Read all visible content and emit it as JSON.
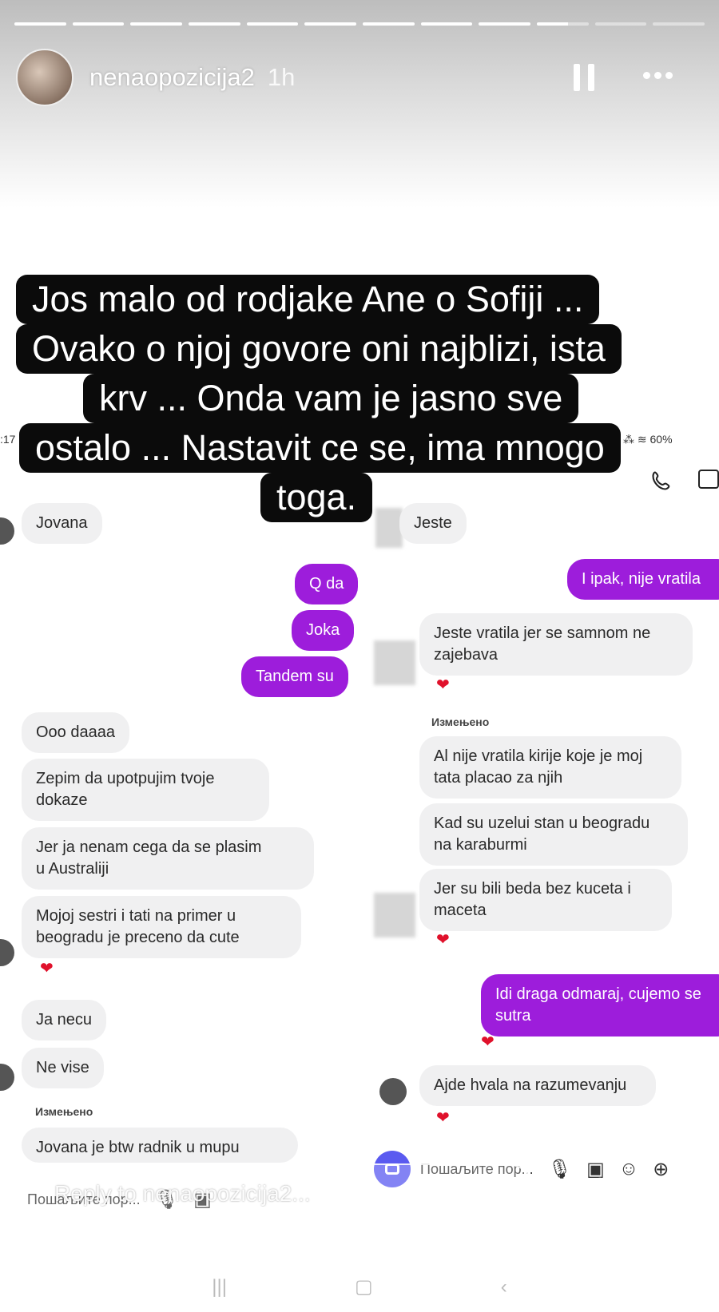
{
  "story": {
    "username": "nenaopozicija2",
    "time": "1h",
    "progress": [
      1,
      1,
      1,
      1,
      1,
      1,
      1,
      1,
      1,
      0.6,
      0,
      0
    ]
  },
  "caption": {
    "lines": [
      "Jos malo od rodjake Ane o Sofiji ...",
      "Ovako  o njoj govore oni najblizi, ista",
      "krv ... Onda vam je jasno sve",
      "ostalo ... Nastavit ce se, ima mnogo",
      "toga."
    ]
  },
  "left_chat": {
    "status_time": ":17",
    "contact": "Jovana",
    "messages": [
      {
        "text": "Q da",
        "dir": "out"
      },
      {
        "text": "Joka",
        "dir": "out"
      },
      {
        "text": "Tandem su",
        "dir": "out"
      },
      {
        "text": "Ooo daaaa",
        "dir": "in"
      },
      {
        "text": "Zepim da upotpujim tvoje\ndokaze",
        "dir": "in"
      },
      {
        "text": "Jer ja nenam cega da se plasim\nu Australiji",
        "dir": "in"
      },
      {
        "text": "Mojoj sestri i tati na primer u\nbeogradu  je preceno da cute",
        "dir": "in"
      },
      {
        "text": "Ja necu",
        "dir": "in"
      },
      {
        "text": "Ne vise",
        "dir": "in"
      },
      {
        "text": "Jovana je btw radnik u mupu",
        "dir": "in"
      }
    ],
    "edited_label": "Измењено",
    "composer_placeholder": "Пошаљите пор..."
  },
  "right_chat": {
    "status_battery": "60%",
    "contact": "Jeste",
    "messages": [
      {
        "text": "I ipak, nije vratila",
        "dir": "out"
      },
      {
        "text": "Jeste vratila jer se samnom ne\nzajebava",
        "dir": "in"
      },
      {
        "text": "Al nije vratila kirije koje je moj\ntata placao za njih",
        "dir": "in"
      },
      {
        "text": "Kad su uzelui stan u beogradu\nna karaburmi",
        "dir": "in"
      },
      {
        "text": "Jer su bili beda bez kuceta i\nmaceta",
        "dir": "in"
      },
      {
        "text": "Idi draga odmaraj, cujemo se\nsutra",
        "dir": "out"
      },
      {
        "text": "Ajde hvala na razumevanju",
        "dir": "in"
      }
    ],
    "edited_label": "Измењено",
    "composer_placeholder": "Пошаљите пор..."
  },
  "reply": {
    "placeholder": "Reply to nenaopozicija2..."
  },
  "colors": {
    "outgoing": "#9d1ddb",
    "incoming": "#f0f0f1",
    "heart": "#e0112b"
  }
}
